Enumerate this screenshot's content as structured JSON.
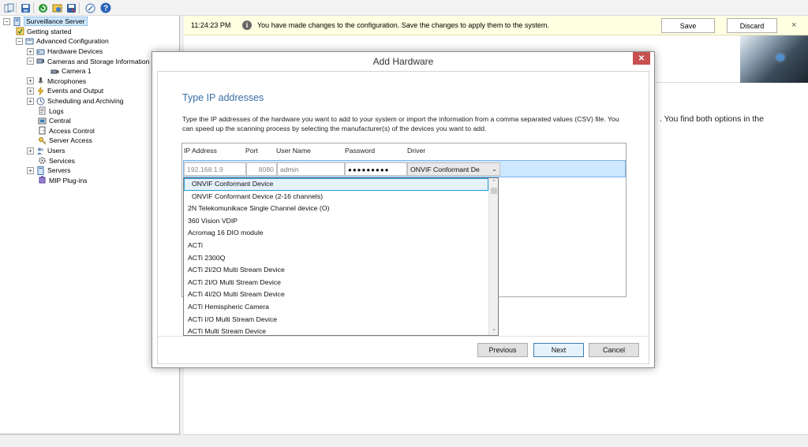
{
  "toolbar": {
    "buttons": [
      "menu-icon",
      "save-icon",
      "refresh-icon",
      "configuration-icon",
      "save-all-icon",
      "link-icon",
      "help-icon"
    ]
  },
  "tree": {
    "items": [
      {
        "label": "Surveillance Server",
        "icon": "server-icon",
        "expander": "−"
      },
      {
        "label": "Getting started",
        "icon": "getting-started-icon",
        "expander": ""
      },
      {
        "label": "Advanced Configuration",
        "icon": "advanced-config-icon",
        "expander": "−"
      },
      {
        "label": "Hardware Devices",
        "icon": "hardware-icon",
        "expander": "+"
      },
      {
        "label": "Cameras and Storage Information",
        "icon": "camera-storage-icon",
        "expander": "−"
      },
      {
        "label": "Camera 1",
        "icon": "camera-icon",
        "expander": ""
      },
      {
        "label": "Microphones",
        "icon": "microphone-icon",
        "expander": "+"
      },
      {
        "label": "Events and Output",
        "icon": "events-icon",
        "expander": "+"
      },
      {
        "label": "Scheduling and Archiving",
        "icon": "scheduling-icon",
        "expander": "+"
      },
      {
        "label": "Logs",
        "icon": "logs-icon",
        "expander": ""
      },
      {
        "label": "Central",
        "icon": "central-icon",
        "expander": ""
      },
      {
        "label": "Access Control",
        "icon": "access-control-icon",
        "expander": ""
      },
      {
        "label": "Server Access",
        "icon": "server-access-icon",
        "expander": ""
      },
      {
        "label": "Users",
        "icon": "users-icon",
        "expander": "+"
      },
      {
        "label": "Services",
        "icon": "services-icon",
        "expander": ""
      },
      {
        "label": "Servers",
        "icon": "servers-icon",
        "expander": "+"
      },
      {
        "label": "MIP Plug-ins",
        "icon": "plugin-icon",
        "expander": ""
      }
    ]
  },
  "notification": {
    "time": "11:24:23 PM",
    "icon": "info-icon",
    "icon_glyph": "i",
    "message": "You have made changes to the configuration. Save the changes to apply them to the system.",
    "save_label": "Save",
    "discard_label": "Discard",
    "close_glyph": "×"
  },
  "content": {
    "text": ". You find both options in the"
  },
  "dialog": {
    "title": "Add Hardware",
    "close_glyph": "✕",
    "heading": "Type IP addresses",
    "description": "Type the IP addresses of the hardware you want to add to your system or import the information from a comma separated values (CSV) file. You can speed up the scanning process by selecting the manufacturer(s) of the devices you want to add.",
    "columns": [
      "IP Address",
      "Port",
      "User Name",
      "Password",
      "Driver"
    ],
    "row": {
      "ip": "192.168.1.9",
      "port": "8080",
      "username": "admin",
      "password": "●●●●●●●●●",
      "driver": "ONVIF Conformant De",
      "chevron": "⌄"
    },
    "driver_options": [
      "ONVIF Conformant Device",
      "ONVIF Conformant Device (2-16 channels)",
      "2N Telekomunikace Single Channel device (O)",
      "360 Vision VDIP",
      "Acromag 16 DIO module",
      "ACTi",
      "ACTi 2300Q",
      "ACTi 2I/2O Multi Stream Device",
      "ACTi 2I/O Multi Stream Device",
      "ACTi 4I/2O Multi Stream Device",
      "ACTi Hemispheric Camera",
      "ACTi I/O Multi Stream Device",
      "ACTi Multi Stream Device"
    ],
    "selected_option_index": 0,
    "scroll_up": "⌃",
    "scroll_down": "⌄",
    "buttons": {
      "previous": "Previous",
      "next": "Next",
      "cancel": "Cancel"
    }
  }
}
